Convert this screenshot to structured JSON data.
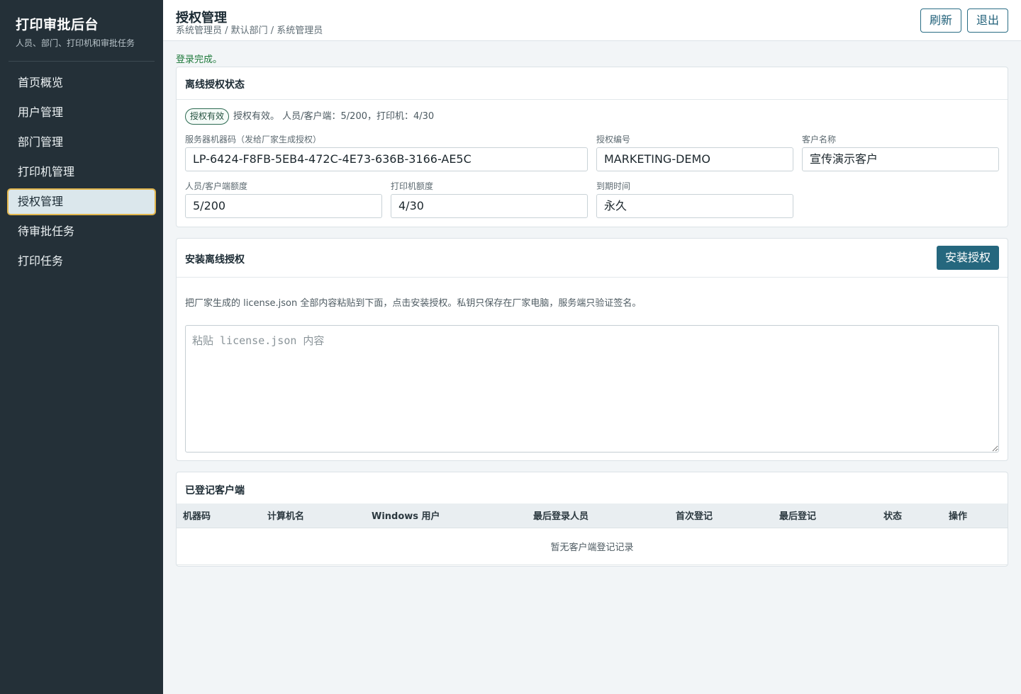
{
  "sidebar": {
    "brand_title": "打印审批后台",
    "brand_subtitle": "人员、部门、打印机和审批任务",
    "items": [
      {
        "label": "首页概览",
        "active": false
      },
      {
        "label": "用户管理",
        "active": false
      },
      {
        "label": "部门管理",
        "active": false
      },
      {
        "label": "打印机管理",
        "active": false
      },
      {
        "label": "授权管理",
        "active": true
      },
      {
        "label": "待审批任务",
        "active": false
      },
      {
        "label": "打印任务",
        "active": false
      }
    ]
  },
  "header": {
    "title": "授权管理",
    "breadcrumb": "系统管理员 / 默认部门 / 系统管理员",
    "refresh_label": "刷新",
    "logout_label": "退出"
  },
  "login_message": "登录完成。",
  "offline_status": {
    "title": "离线授权状态",
    "badge": "授权有效",
    "summary": "授权有效。 人员/客户端：5/200，打印机：4/30",
    "fields": {
      "machine_code": {
        "label": "服务器机器码（发给厂家生成授权）",
        "value": "LP-6424-F8FB-5EB4-472C-4E73-636B-3166-AE5C"
      },
      "license_no": {
        "label": "授权编号",
        "value": "MARKETING-DEMO"
      },
      "customer_name": {
        "label": "客户名称",
        "value": "宣传演示客户"
      },
      "client_quota": {
        "label": "人员/客户端额度",
        "value": "5/200"
      },
      "printer_quota": {
        "label": "打印机额度",
        "value": "4/30"
      },
      "expiry": {
        "label": "到期时间",
        "value": "永久"
      }
    }
  },
  "install": {
    "title": "安装离线授权",
    "button_label": "安装授权",
    "hint": "把厂家生成的 license.json 全部内容粘贴到下面，点击安装授权。私钥只保存在厂家电脑，服务端只验证签名。",
    "placeholder": "粘贴 license.json 内容",
    "value": ""
  },
  "clients": {
    "title": "已登记客户端",
    "columns": [
      "机器码",
      "计算机名",
      "Windows 用户",
      "最后登录人员",
      "首次登记",
      "最后登记",
      "状态",
      "操作"
    ],
    "empty_text": "暂无客户端登记记录"
  },
  "colors": {
    "sidebar_bg": "#243038",
    "accent": "#25677e",
    "active_border": "#e2b64c",
    "success_text": "#1f7a3c"
  }
}
